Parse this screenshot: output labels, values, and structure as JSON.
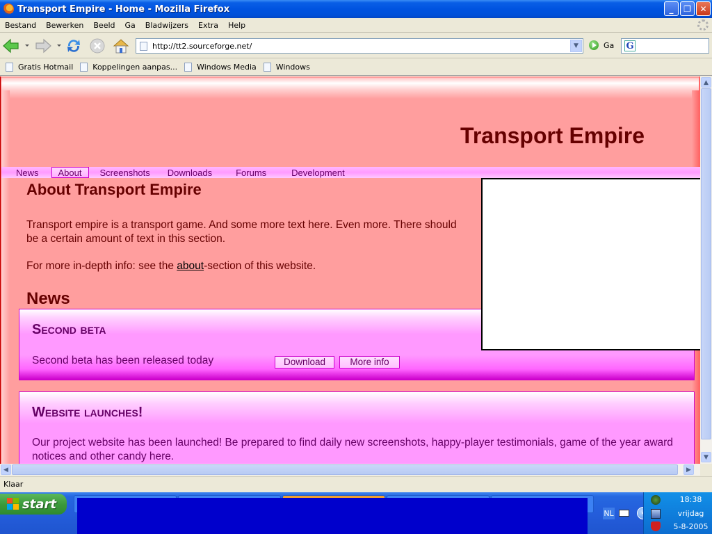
{
  "window": {
    "title": "Transport Empire - Home - Mozilla Firefox",
    "controls": {
      "minimize": "–",
      "restore": "❐",
      "close": "✕"
    }
  },
  "menubar": {
    "items": [
      "Bestand",
      "Bewerken",
      "Beeld",
      "Ga",
      "Bladwijzers",
      "Extra",
      "Help"
    ]
  },
  "toolbar": {
    "back_icon": "back-arrow-icon",
    "forward_icon": "forward-arrow-icon",
    "reload_icon": "reload-icon",
    "stop_icon": "stop-icon",
    "home_icon": "home-icon",
    "url": "http://tt2.sourceforge.net/",
    "go_label": "Ga",
    "search_value": ""
  },
  "bookmarks": {
    "items": [
      "Gratis Hotmail",
      "Koppelingen aanpas...",
      "Windows Media",
      "Windows"
    ]
  },
  "page": {
    "site_title": "Transport Empire",
    "nav": [
      {
        "label": "News",
        "active": false
      },
      {
        "label": "About",
        "active": true
      },
      {
        "label": "Screenshots",
        "active": false
      },
      {
        "label": "Downloads",
        "active": false
      },
      {
        "label": "Forums",
        "active": false
      },
      {
        "label": "Development",
        "active": false
      }
    ],
    "about": {
      "title": "About Transport Empire",
      "text": "Transport empire is a transport game. And some more text here. Even more. There should be a certain amount of text in this section.",
      "more_prefix": "For more in-depth info: see the ",
      "more_link": "about",
      "more_suffix": "-section of this website."
    },
    "news_title": "News",
    "news": [
      {
        "title": "Second beta",
        "text": "Second beta has been released today",
        "buttons": [
          "Download",
          "More info"
        ]
      },
      {
        "title": "Website launches!",
        "text": "Our project website has been launched! Be prepared to find daily new screenshots, happy-player testimonials, game of the year award notices and other candy here."
      }
    ]
  },
  "statusbar": {
    "text": "Klaar"
  },
  "taskbar": {
    "start_label": "start",
    "language": "NL",
    "clock": {
      "time": "18:38",
      "day": "vrijdag",
      "date": "5-8-2005"
    }
  },
  "colors": {
    "page_bg": "#FF9E9E",
    "title_color": "#660000",
    "nav_bg": "#FF9AFF",
    "news_box_bg": "#FF99FF",
    "news_text": "#660066",
    "accent_border": "#CC00CC"
  }
}
